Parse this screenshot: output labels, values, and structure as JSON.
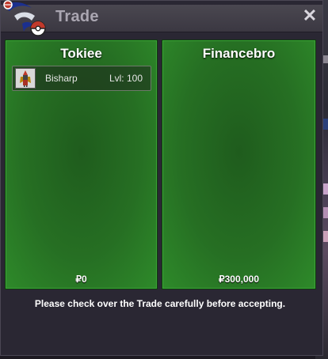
{
  "window": {
    "title": "Trade",
    "close_glyph": "✕"
  },
  "left_panel": {
    "name": "Tokiee",
    "items": [
      {
        "name": "Bisharp",
        "level": "Lvl: 100",
        "icon": "bisharp-sprite"
      }
    ],
    "money": "₽0"
  },
  "right_panel": {
    "name": "Financebro",
    "items": [],
    "money": "₽300,000"
  },
  "notice": "Please check over the Trade carefully before accepting.",
  "colors": {
    "panel_green": "#2e8a2a",
    "window_bg": "#2a2733",
    "title_text": "#aaa6b1"
  }
}
